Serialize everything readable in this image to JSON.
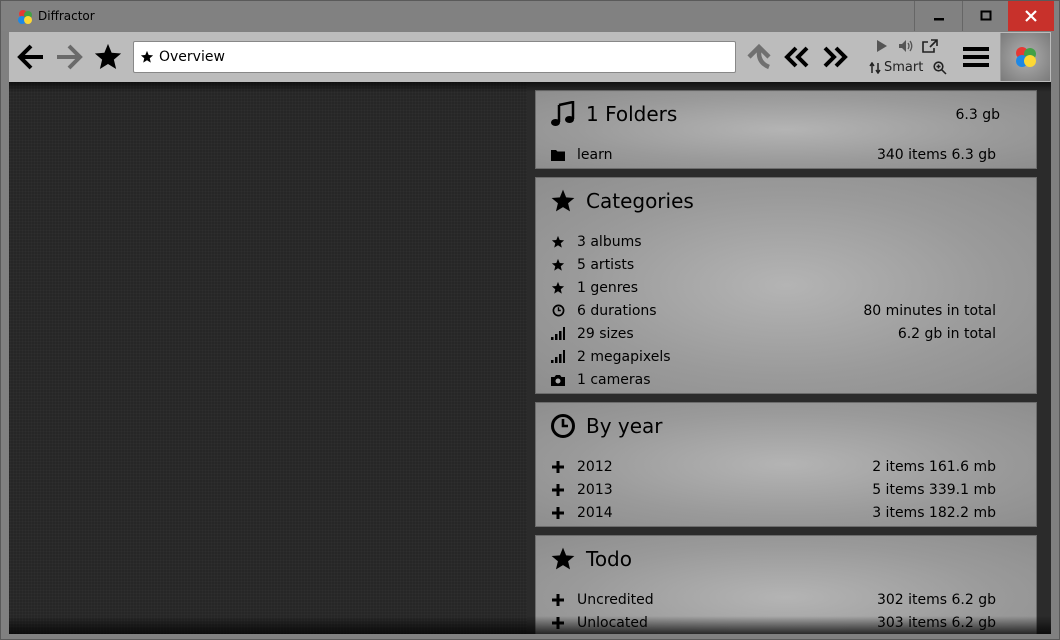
{
  "window": {
    "title": "Diffractor",
    "controls": {
      "minimize": "—",
      "maximize": "□",
      "close": "✕"
    }
  },
  "toolbar": {
    "address_value": "Overview",
    "sort_label": "Smart",
    "icons": [
      "back-arrow-icon",
      "forward-arrow-icon",
      "star-icon",
      "up-arrow-icon",
      "previous-icon",
      "next-icon",
      "play-icon",
      "volume-icon",
      "external-link-icon",
      "sort-icon",
      "zoom-icon",
      "menu-icon"
    ]
  },
  "panels": {
    "folders": {
      "title": "1 Folders",
      "total": "6.3 gb",
      "icon": "music-note-icon",
      "rows": [
        {
          "icon": "folder-icon",
          "label": "learn",
          "value": "340 items 6.3 gb"
        }
      ]
    },
    "categories": {
      "title": "Categories",
      "icon": "star-icon",
      "rows": [
        {
          "icon": "star-icon",
          "label": "3 albums",
          "value": ""
        },
        {
          "icon": "star-icon",
          "label": "5 artists",
          "value": ""
        },
        {
          "icon": "star-icon",
          "label": "1 genres",
          "value": ""
        },
        {
          "icon": "clock-icon",
          "label": "6 durations",
          "value": "80 minutes in total"
        },
        {
          "icon": "bars-icon",
          "label": "29 sizes",
          "value": "6.2 gb in total"
        },
        {
          "icon": "bars-icon",
          "label": "2 megapixels",
          "value": ""
        },
        {
          "icon": "camera-icon",
          "label": "1 cameras",
          "value": ""
        }
      ]
    },
    "by_year": {
      "title": "By year",
      "icon": "clock-icon",
      "rows": [
        {
          "icon": "plus-icon",
          "label": "2012",
          "value": "2 items 161.6 mb"
        },
        {
          "icon": "plus-icon",
          "label": "2013",
          "value": "5 items 339.1 mb"
        },
        {
          "icon": "plus-icon",
          "label": "2014",
          "value": "3 items 182.2 mb"
        }
      ]
    },
    "todo": {
      "title": "Todo",
      "icon": "star-icon",
      "rows": [
        {
          "icon": "plus-icon",
          "label": "Uncredited",
          "value": "302 items 6.2 gb"
        },
        {
          "icon": "plus-icon",
          "label": "Unlocated",
          "value": "303 items 6.2 gb"
        }
      ]
    }
  },
  "colors": {
    "close_button": "#c8312b",
    "titlebar": "#818181",
    "toolbar": "#bcbcbc",
    "content_bg": "#262626",
    "panel": "#a8a8a8"
  }
}
